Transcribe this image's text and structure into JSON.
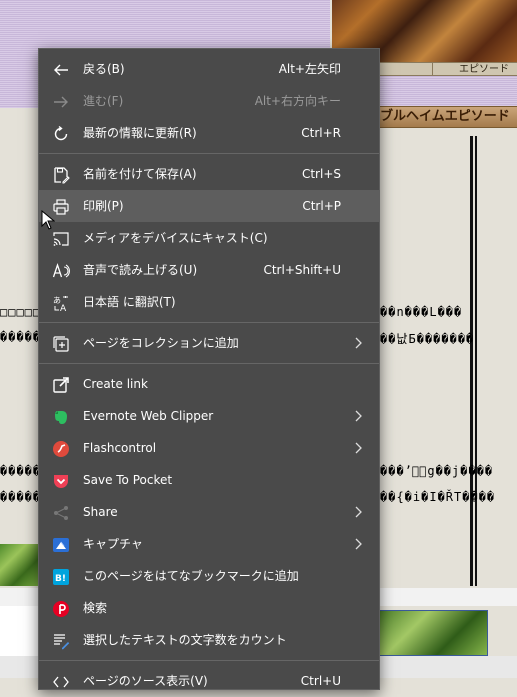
{
  "background": {
    "tab_label": "エピソード",
    "title_bar": "ブルヘイムエピソード",
    "garbled_lines": [
      "□□□□□□□",
      "����������",
      "����������",
      "����������",
      "��n���L���",
      "��낪Б�������",
      "���ʼ゙゚g��j����",
      "��{�i�I�ŘT����"
    ]
  },
  "menu": {
    "items": [
      {
        "label": "戻る(B)",
        "shortcut": "Alt+左矢印",
        "icon": "back-arrow-icon"
      },
      {
        "label": "進む(F)",
        "shortcut": "Alt+右方向キー",
        "icon": "forward-arrow-icon",
        "disabled": true
      },
      {
        "label": "最新の情報に更新(R)",
        "shortcut": "Ctrl+R",
        "icon": "refresh-icon"
      },
      {
        "label": "名前を付けて保存(A)",
        "shortcut": "Ctrl+S",
        "icon": "save-as-icon"
      },
      {
        "label": "印刷(P)",
        "shortcut": "Ctrl+P",
        "icon": "print-icon"
      },
      {
        "label": "メディアをデバイスにキャスト(C)",
        "shortcut": "",
        "icon": "cast-icon"
      },
      {
        "label": "音声で読み上げる(U)",
        "shortcut": "Ctrl+Shift+U",
        "icon": "read-aloud-icon"
      },
      {
        "label": "日本語 に翻訳(T)",
        "shortcut": "",
        "icon": "translate-icon"
      },
      {
        "label": "ページをコレクションに追加",
        "shortcut": "",
        "icon": "collections-icon"
      },
      {
        "label": "Create link",
        "shortcut": "",
        "icon": "create-link-icon"
      },
      {
        "label": "Evernote Web Clipper",
        "shortcut": "",
        "icon": "evernote-icon"
      },
      {
        "label": "Flashcontrol",
        "shortcut": "",
        "icon": "flashcontrol-icon"
      },
      {
        "label": "Save To Pocket",
        "shortcut": "",
        "icon": "pocket-icon"
      },
      {
        "label": "Share",
        "shortcut": "",
        "icon": "share-icon"
      },
      {
        "label": "キャプチャ",
        "shortcut": "",
        "icon": "capture-icon"
      },
      {
        "label": "このページをはてなブックマークに追加",
        "shortcut": "",
        "icon": "hatena-bookmark-icon"
      },
      {
        "label": "検索",
        "shortcut": "",
        "icon": "pinterest-icon"
      },
      {
        "label": "選択したテキストの文字数をカウント",
        "shortcut": "",
        "icon": "text-count-icon"
      },
      {
        "label": "ページのソース表示(V)",
        "shortcut": "Ctrl+U",
        "icon": "view-source-icon"
      }
    ]
  },
  "colors": {
    "menu_bg": "#4a4a4a",
    "highlight": "#5e5e5e",
    "evernote": "#2dbe60",
    "flashcontrol": "#e04a3c",
    "pocket": "#ef4056",
    "capture": "#2b6fd6",
    "hatena": "#00a4de",
    "pinterest": "#e60023"
  }
}
